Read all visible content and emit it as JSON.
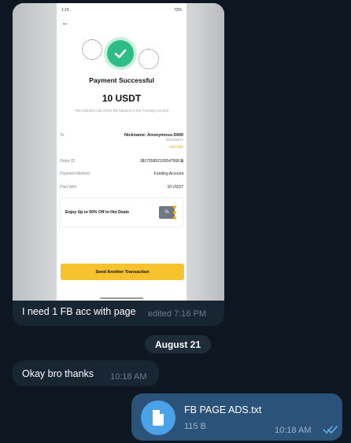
{
  "photo": {
    "status_time": "1:15",
    "status_right": "72%",
    "title": "Payment Successful",
    "amount": "10 USDT",
    "note": "The recipient can check the balance in the Funding Account",
    "to_label": "To",
    "nickname": "Nickname: Anonymous-5400",
    "uid": "353126572",
    "add_address": "Add Addr",
    "order_id_label": "Order ID",
    "order_id": "381755892126547968",
    "method_label": "Payment Method",
    "method": "Funding Account",
    "paid_label": "Paid With",
    "paid": "10 USDT",
    "promo": "Enjoy Up to 50% Off in Hot Deals",
    "promo_icon": "%",
    "send_button": "Send Another Transaction"
  },
  "msg1": {
    "text": "I need 1 FB acc with page",
    "meta": "edited 7:16 PM"
  },
  "date_chip": "August 21",
  "msg2": {
    "text": "Okay bro thanks",
    "time": "10:18 AM"
  },
  "msg3": {
    "file_name": "FB PAGE ADS.txt",
    "file_size": "115 B",
    "time": "10:18 AM"
  },
  "colors": {
    "bg": "#0e1621",
    "incoming": "#182533",
    "outgoing": "#2b5278",
    "accent": "#4aa3e6"
  }
}
